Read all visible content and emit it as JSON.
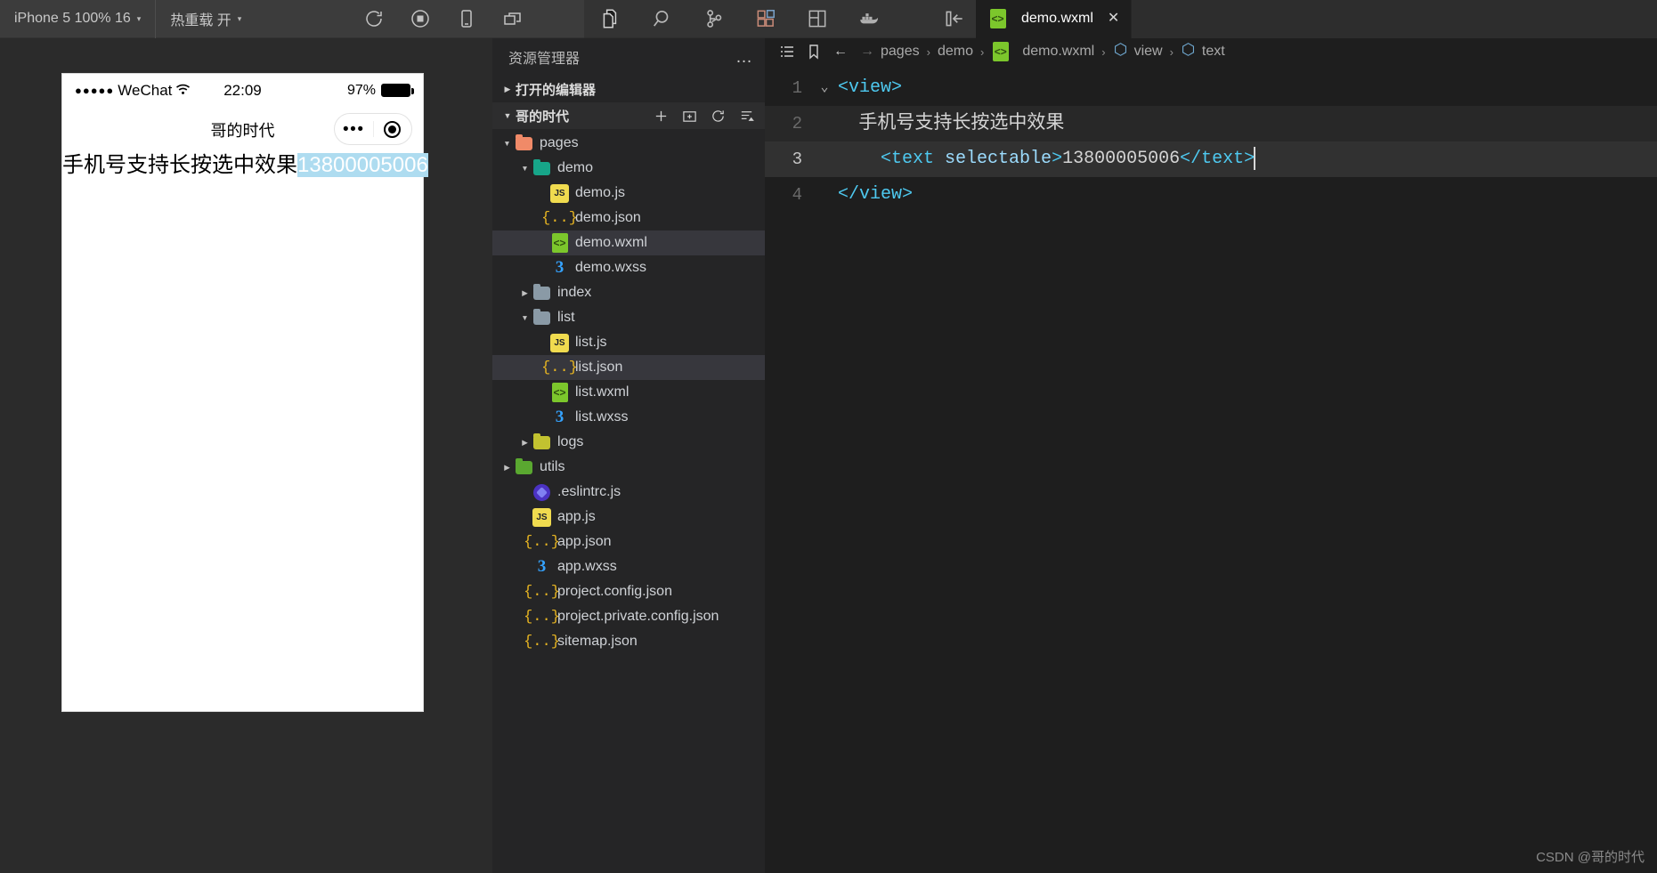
{
  "simulator_toolbar": {
    "device_selector": {
      "label": "iPhone 5 100% 16",
      "caret": "▾"
    },
    "hot_reload": {
      "label": "热重载 开",
      "caret": "▾"
    },
    "icons": [
      {
        "name": "refresh-icon",
        "glyph": "refresh"
      },
      {
        "name": "stop-record-icon",
        "glyph": "stop"
      },
      {
        "name": "device-icon",
        "glyph": "phone"
      },
      {
        "name": "multi-window-icon",
        "glyph": "windows"
      }
    ]
  },
  "activity_bar": {
    "icons": [
      {
        "name": "explorer-icon",
        "glyph": "files"
      },
      {
        "name": "search-icon",
        "glyph": "magnifier"
      },
      {
        "name": "source-control-icon",
        "glyph": "branch"
      },
      {
        "name": "extensions-icon",
        "glyph": "blocks"
      },
      {
        "name": "layout-icon",
        "glyph": "panel"
      },
      {
        "name": "docker-icon",
        "glyph": "docker"
      },
      {
        "name": "toggle-sidebar-icon",
        "glyph": "collapse"
      }
    ]
  },
  "tabs": [
    {
      "label": "demo.wxml",
      "icon": "wxml-file-icon",
      "close": "✕",
      "active": true
    }
  ],
  "simulator": {
    "status_bar": {
      "signal_dots": "●●●●●",
      "carrier": "WeChat",
      "wifi": "wifi-icon",
      "time": "22:09",
      "battery_percent": "97%"
    },
    "nav_title": "哥的时代",
    "capsule": {
      "menu_dots": "•••",
      "target": "target-icon"
    },
    "page_text": "手机号支持长按选中效果",
    "page_selected_text": "13800005006"
  },
  "sidebar": {
    "title": "资源管理器",
    "more": "…",
    "open_editors": {
      "label": "打开的编辑器",
      "twisty": "▶"
    },
    "project": {
      "label": "哥的时代",
      "twisty": "▼",
      "actions": [
        {
          "name": "new-file-action",
          "glyph": "+"
        },
        {
          "name": "new-folder-action",
          "glyph": "folder-plus"
        },
        {
          "name": "refresh-explorer-action",
          "glyph": "refresh"
        },
        {
          "name": "collapse-all-action",
          "glyph": "collapse-all"
        }
      ]
    },
    "tree": [
      {
        "label": "pages",
        "type": "folder",
        "icon": "folder-pages-icon",
        "indent": 1,
        "twisty": "▼",
        "selected": false
      },
      {
        "label": "demo",
        "type": "folder",
        "icon": "folder-demo-icon",
        "indent": 2,
        "twisty": "▼",
        "selected": false
      },
      {
        "label": "demo.js",
        "type": "js",
        "icon": "js-file-icon",
        "indent": 3,
        "twisty": "",
        "selected": false
      },
      {
        "label": "demo.json",
        "type": "json",
        "icon": "json-file-icon",
        "indent": 3,
        "twisty": "",
        "selected": false
      },
      {
        "label": "demo.wxml",
        "type": "wxml",
        "icon": "wxml-file-icon",
        "indent": 3,
        "twisty": "",
        "selected": true
      },
      {
        "label": "demo.wxss",
        "type": "wxss",
        "icon": "wxss-file-icon",
        "indent": 3,
        "twisty": "",
        "selected": false
      },
      {
        "label": "index",
        "type": "folder",
        "icon": "folder-index-icon",
        "indent": 2,
        "twisty": "▶",
        "selected": false
      },
      {
        "label": "list",
        "type": "folder",
        "icon": "folder-list-icon",
        "indent": 2,
        "twisty": "▼",
        "selected": false
      },
      {
        "label": "list.js",
        "type": "js",
        "icon": "js-file-icon",
        "indent": 3,
        "twisty": "",
        "selected": false
      },
      {
        "label": "list.json",
        "type": "json",
        "icon": "json-file-icon",
        "indent": 3,
        "twisty": "",
        "selected": true
      },
      {
        "label": "list.wxml",
        "type": "wxml",
        "icon": "wxml-file-icon",
        "indent": 3,
        "twisty": "",
        "selected": false
      },
      {
        "label": "list.wxss",
        "type": "wxss",
        "icon": "wxss-file-icon",
        "indent": 3,
        "twisty": "",
        "selected": false
      },
      {
        "label": "logs",
        "type": "folder",
        "icon": "folder-logs-icon",
        "indent": 2,
        "twisty": "▶",
        "selected": false
      },
      {
        "label": "utils",
        "type": "folder",
        "icon": "folder-utils-icon",
        "indent": 1,
        "twisty": "▶",
        "selected": false
      },
      {
        "label": ".eslintrc.js",
        "type": "eslint",
        "icon": "eslint-file-icon",
        "indent": 2,
        "twisty": "",
        "selected": false
      },
      {
        "label": "app.js",
        "type": "js",
        "icon": "js-file-icon",
        "indent": 2,
        "twisty": "",
        "selected": false
      },
      {
        "label": "app.json",
        "type": "json",
        "icon": "json-file-icon",
        "indent": 2,
        "twisty": "",
        "selected": false
      },
      {
        "label": "app.wxss",
        "type": "wxss",
        "icon": "wxss-file-icon",
        "indent": 2,
        "twisty": "",
        "selected": false
      },
      {
        "label": "project.config.json",
        "type": "json",
        "icon": "json-file-icon",
        "indent": 2,
        "twisty": "",
        "selected": false
      },
      {
        "label": "project.private.config.json",
        "type": "json",
        "icon": "json-file-icon",
        "indent": 2,
        "twisty": "",
        "selected": false
      },
      {
        "label": "sitemap.json",
        "type": "json",
        "icon": "json-file-icon",
        "indent": 2,
        "twisty": "",
        "selected": false
      }
    ]
  },
  "breadcrumb": {
    "outline_icon": "outline-icon",
    "bookmark_icon": "bookmark-icon",
    "back_icon": "←",
    "forward_icon": "→",
    "items": [
      "pages",
      "demo",
      "demo.wxml",
      "view",
      "text"
    ],
    "separator": "›"
  },
  "code": {
    "lines": [
      {
        "number": "1",
        "fold": "⌄",
        "tokens": [
          {
            "cls": "tk-tag",
            "text": "<view>"
          }
        ]
      },
      {
        "number": "2",
        "fold": "",
        "tokens": [
          {
            "cls": "tk-cn",
            "text": "    手机号支持长按选中效果"
          }
        ]
      },
      {
        "number": "3",
        "fold": "",
        "tokens": [
          {
            "cls": "tk-tag",
            "text": "    <text "
          },
          {
            "cls": "tk-attr",
            "text": "selectable"
          },
          {
            "cls": "tk-tag",
            "text": ">"
          },
          {
            "cls": "tk-num",
            "text": "13800005006"
          },
          {
            "cls": "tk-tag",
            "text": "</text>"
          }
        ]
      },
      {
        "number": "4",
        "fold": "",
        "tokens": [
          {
            "cls": "tk-tag",
            "text": "</view>"
          }
        ]
      }
    ],
    "active_line": "3"
  },
  "watermark": "CSDN @哥的时代",
  "colors": {
    "editor_bg": "#1e1e1e",
    "sidebar_bg": "#252526",
    "topbar_bg": "#3c3c3c",
    "accent_tag": "#4ec9f0",
    "accent_attr": "#9cdcfe",
    "selection_highlight": "#aedcf0",
    "row_selected": "#37373d"
  }
}
